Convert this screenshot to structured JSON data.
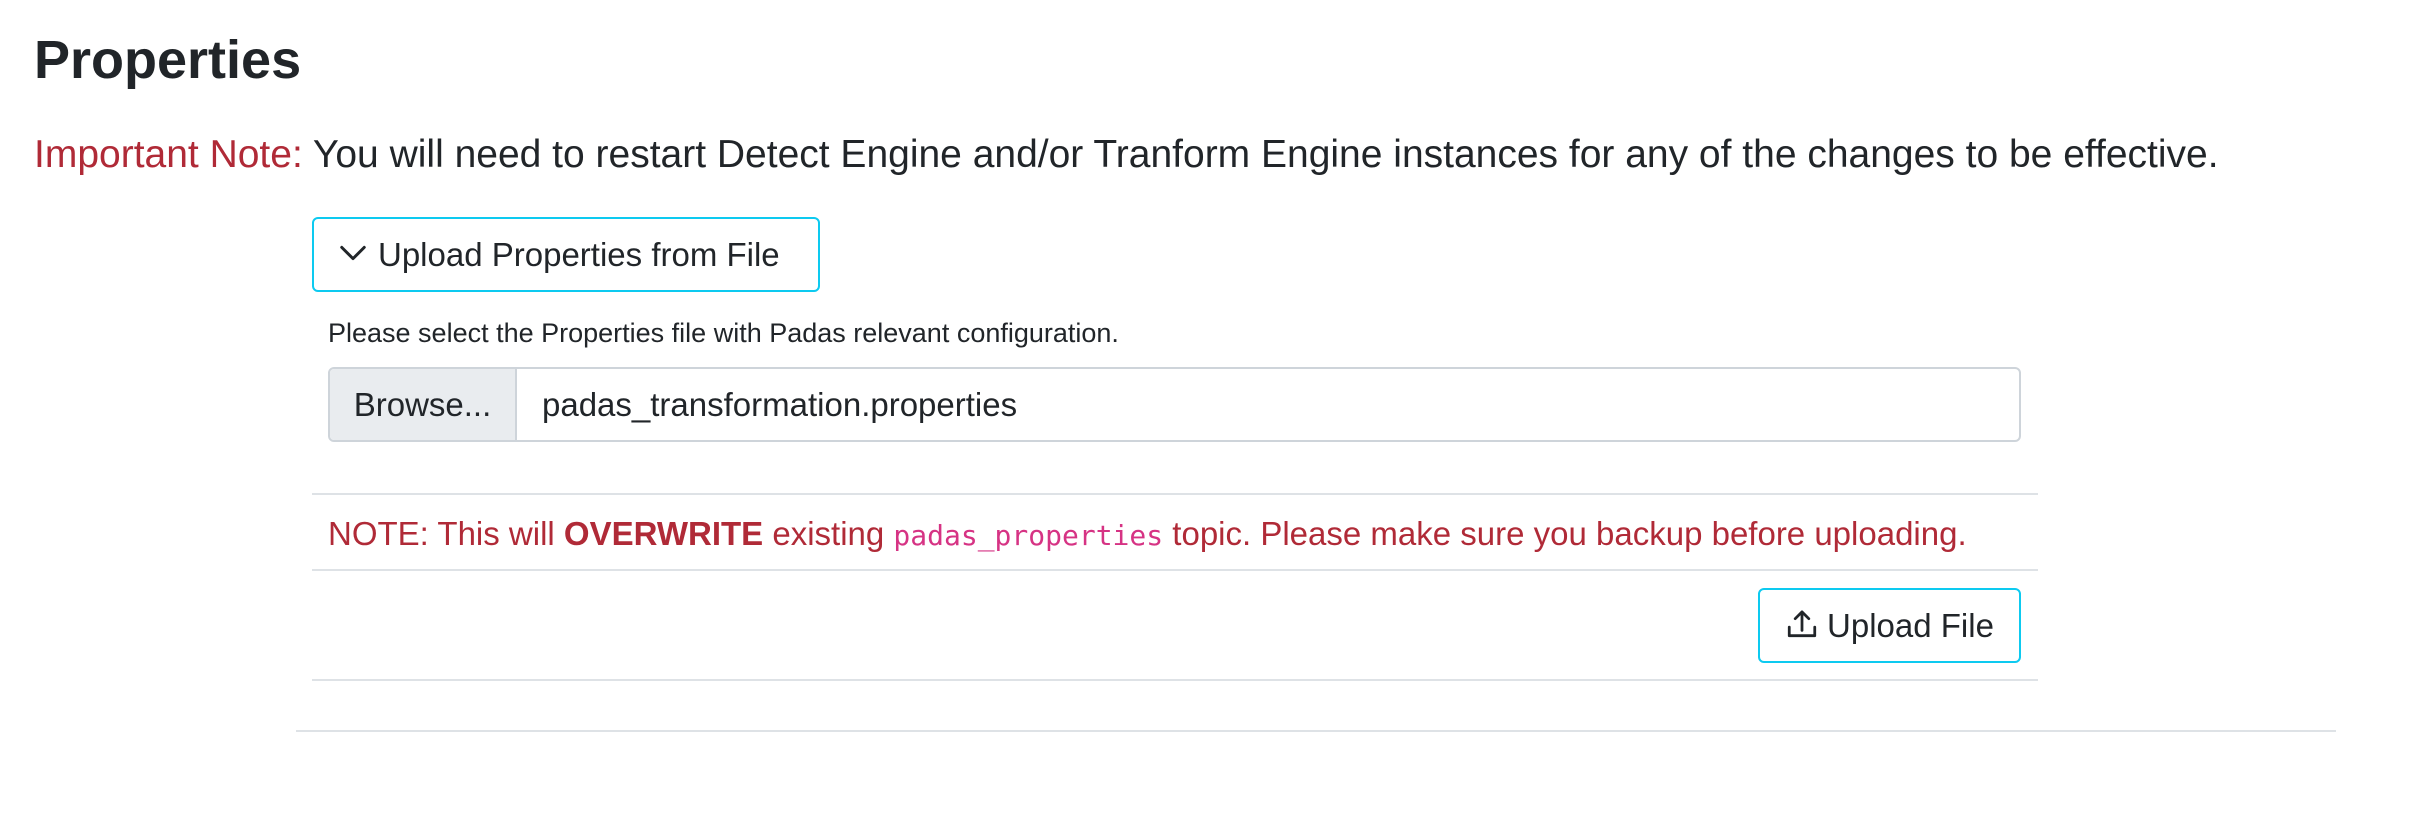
{
  "page": {
    "title": "Properties"
  },
  "important_note": {
    "label": "Important Note:",
    "text": " You will need to restart Detect Engine and/or Tranform Engine instances for any of the changes to be effective."
  },
  "upload_section": {
    "toggle_label": "Upload Properties from File",
    "helper_text": "Please select the Properties file with Padas relevant configuration.",
    "browse_label": "Browse...",
    "file_name": "padas_transformation.properties",
    "warning": {
      "prefix": "NOTE: This will ",
      "emphasis": "OVERWRITE",
      "middle": " existing ",
      "topic_code": "padas_properties",
      "suffix": " topic. Please make sure you backup before uploading."
    },
    "upload_button_label": "Upload File"
  },
  "colors": {
    "danger": "#b02a37",
    "info_border": "#0dcaf0",
    "code": "#d63384",
    "divider": "#dee2e6"
  },
  "icons": {
    "toggle": "chevron-down-icon",
    "upload": "upload-icon"
  }
}
